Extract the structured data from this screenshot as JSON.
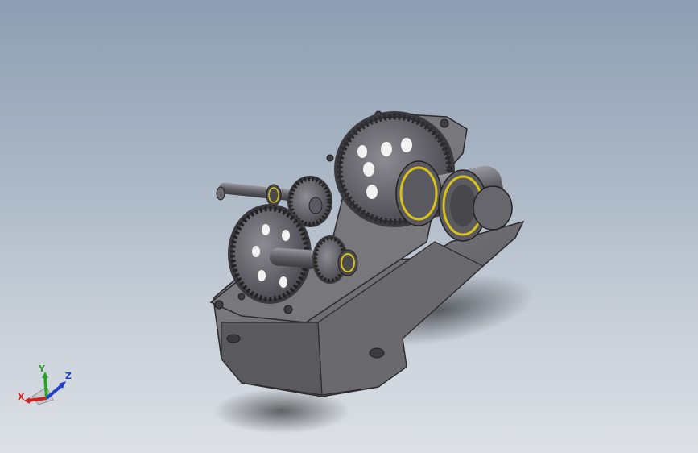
{
  "viewport": {
    "background_top": "#8e9eb2",
    "background_bottom": "#dde1e6"
  },
  "model": {
    "part_color": "#6c6c70",
    "bearing_accent": "#d8c21a"
  },
  "triad": {
    "x_label": "X",
    "y_label": "Y",
    "z_label": "Z",
    "x_color": "#d02020",
    "y_color": "#2aa02a",
    "z_color": "#2040c8"
  }
}
